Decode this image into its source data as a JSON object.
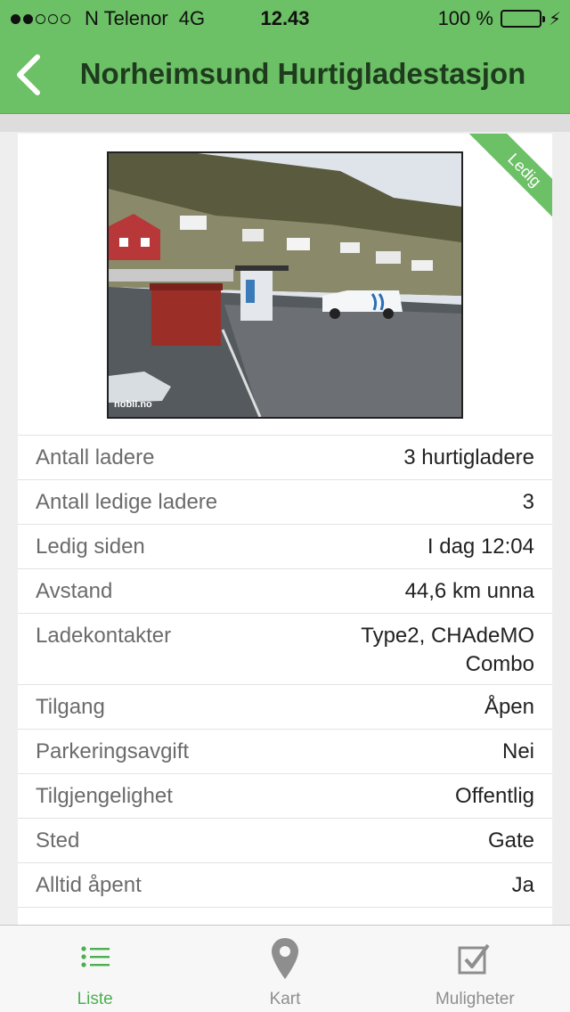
{
  "status_bar": {
    "carrier": "N Telenor",
    "network": "4G",
    "time": "12.43",
    "battery": "100 %",
    "signal_strength": 2
  },
  "nav": {
    "title": "Norheimsund Hurtigladestasjon",
    "back_icon": "chevron-left-icon"
  },
  "station": {
    "badge": "Ledig",
    "photo_watermark": "nobil.no",
    "details": [
      {
        "label": "Antall ladere",
        "value": "3 hurtigladere"
      },
      {
        "label": "Antall ledige ladere",
        "value": "3"
      },
      {
        "label": "Ledig siden",
        "value": "I dag 12:04"
      },
      {
        "label": "Avstand",
        "value": "44,6 km unna"
      },
      {
        "label": "Ladekontakter",
        "value": "Type2, CHAdeMO",
        "value2": "Combo"
      },
      {
        "label": "Tilgang",
        "value": "Åpen"
      },
      {
        "label": "Parkeringsavgift",
        "value": "Nei"
      },
      {
        "label": "Tilgjengelighet",
        "value": "Offentlig"
      },
      {
        "label": "Sted",
        "value": "Gate"
      },
      {
        "label": "Alltid åpent",
        "value": "Ja"
      }
    ]
  },
  "tabs": [
    {
      "label": "Liste",
      "icon": "list-icon",
      "active": true
    },
    {
      "label": "Kart",
      "icon": "map-pin-icon",
      "active": false
    },
    {
      "label": "Muligheter",
      "icon": "checkbox-icon",
      "active": false
    }
  ],
  "colors": {
    "accent": "#6cc065",
    "active_tab": "#4caf50",
    "title_text": "#1e3b1e"
  }
}
